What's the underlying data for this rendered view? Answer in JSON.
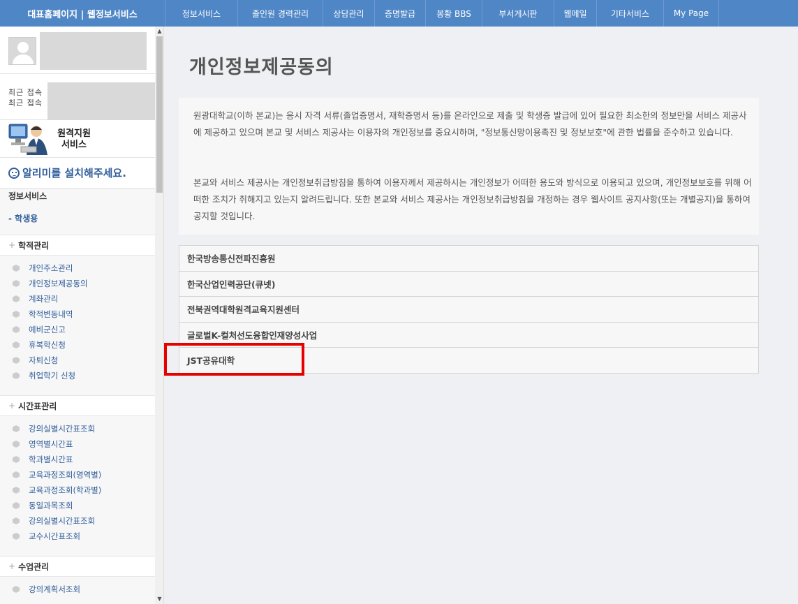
{
  "header": {
    "brand": "대표홈페이지 | 웹정보서비스",
    "nav": [
      "정보서비스",
      "졸인원 경력관리",
      "상담관리",
      "증명발급",
      "봉황 BBS",
      "부서게시판",
      "웹메일",
      "기타서비스",
      "My Page"
    ]
  },
  "sidebar": {
    "login_label_1": "최근 접속",
    "login_label_2": "최근 접속",
    "remote_line1": "원격지원",
    "remote_line2": "서비스",
    "alarm": "알리미를 설치해주세요.",
    "section_title": "정보서비스",
    "student": "- 학생용",
    "groups": [
      {
        "title": "학적관리",
        "items": [
          "개인주소관리",
          "개인정보제공동의",
          "계좌관리",
          "학적변동내역",
          "예비군신고",
          "휴복학신청",
          "자퇴신청",
          "취업학기 신청"
        ]
      },
      {
        "title": "시간표관리",
        "items": [
          "강의실별시간표조회",
          "영역별시간표",
          "학과별시간표",
          "교육과정조회(영역별)",
          "교육과정조회(학과별)",
          "동일과목조회",
          "강의실별시간표조회",
          "교수시간표조회"
        ]
      },
      {
        "title": "수업관리",
        "items": [
          "강의계획서조회"
        ]
      }
    ]
  },
  "main": {
    "title": "개인정보제공동의",
    "notice_p1": "원광대학교(이하 본교)는 응시 자격 서류(졸업증명서, 재학증명서 등)를 온라인으로 제출 및 학생증 발급에 있어 필요한 최소한의 정보만을 서비스 제공사에 제공하고 있으며 본교 및 서비스 제공사는 이용자의 개인정보를 중요시하며, \"정보통신망이용촉진 및 정보보호\"에 관한 법률을 준수하고 있습니다.",
    "notice_p2": "본교와 서비스 제공사는 개인정보취급방침을 통하여 이용자께서 제공하시는 개인정보가 어떠한 용도와 방식으로 이용되고 있으며, 개인정보보호를 위해 어떠한 조치가 취해지고 있는지 알려드립니다. 또한 본교와 서비스 제공사는 개인정보취급방침을 개정하는 경우 웹사이트 공지사항(또는 개별공지)을 통하여 공지할 것입니다.",
    "institutions": [
      "한국방송통신전파진흥원",
      "한국산업인력공단(큐넷)",
      "전북권역대학원격교육지원센터",
      "글로벌K-컬처선도융합인재양성사업",
      "JST공유대학"
    ]
  },
  "colors": {
    "nav_bg": "#4f86c6",
    "link": "#2f5d9a",
    "highlight": "#e60000"
  }
}
